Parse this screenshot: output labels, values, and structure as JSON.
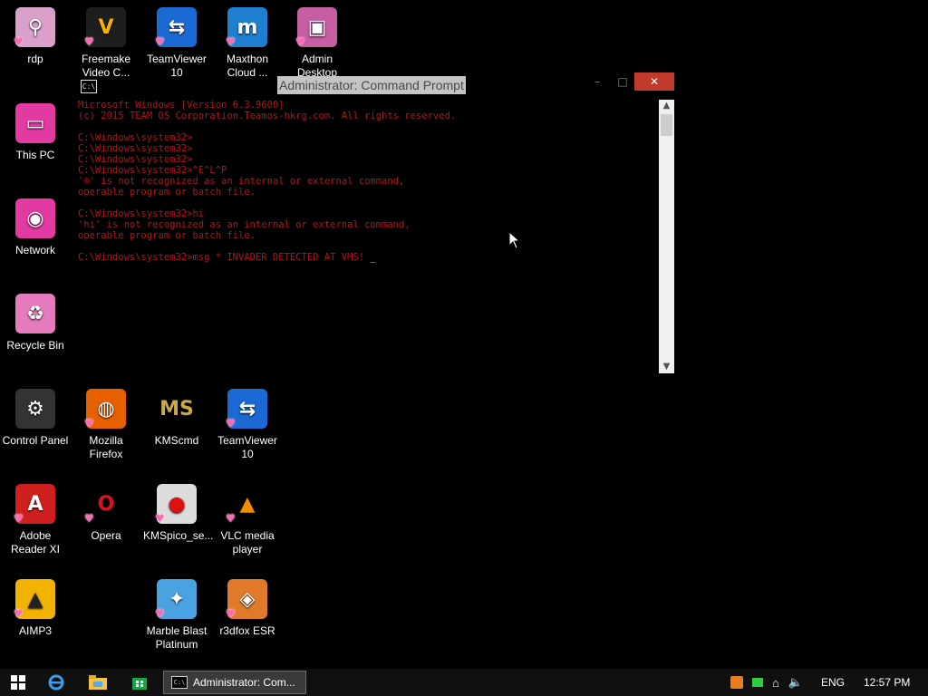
{
  "desktop": {
    "icons": [
      {
        "label": "rdp",
        "icon": "folder-icon",
        "glyph": "⚲",
        "bg": "#d9a0c9"
      },
      {
        "label": "Freemake Video C...",
        "icon": "freemake-icon",
        "glyph": "V",
        "bg": "#1e1e1e",
        "fg": "#f5b400"
      },
      {
        "label": "TeamViewer 10",
        "icon": "teamviewer-icon",
        "glyph": "⇆",
        "bg": "#1b6ad3"
      },
      {
        "label": "Maxthon Cloud ...",
        "icon": "maxthon-icon",
        "glyph": "m",
        "bg": "#1e7fd0"
      },
      {
        "label": "Admin Desktop",
        "icon": "folder-icon",
        "glyph": "▣",
        "bg": "#c75da3"
      },
      {
        "label": "This PC",
        "icon": "computer-icon",
        "glyph": "▭",
        "bg": "#e23aa0"
      },
      {
        "label": "Network",
        "icon": "network-icon",
        "glyph": "◉",
        "bg": "#e23aa0"
      },
      {
        "label": "Recycle Bin",
        "icon": "recycle-bin-icon",
        "glyph": "♻",
        "bg": "#e57bbd"
      },
      {
        "label": "Control Panel",
        "icon": "control-panel-icon",
        "glyph": "⚙",
        "bg": "#333333"
      },
      {
        "label": "Mozilla Firefox",
        "icon": "firefox-icon",
        "glyph": "◍",
        "bg": "#e66000"
      },
      {
        "label": "KMScmd",
        "icon": "kmscmd-icon",
        "glyph": "MS",
        "bg": "#000000",
        "fg": "#c9a94a"
      },
      {
        "label": "TeamViewer 10",
        "icon": "teamviewer-icon",
        "glyph": "⇆",
        "bg": "#1b6ad3"
      },
      {
        "label": "Adobe Reader XI",
        "icon": "adobe-reader-icon",
        "glyph": "A",
        "bg": "#d01f1f"
      },
      {
        "label": "Opera",
        "icon": "opera-icon",
        "glyph": "O",
        "bg": "#000000",
        "fg": "#e00f1f"
      },
      {
        "label": "KMSpico_se...",
        "icon": "kmspico-icon",
        "glyph": "●",
        "bg": "#dcdcdc",
        "fg": "#d11"
      },
      {
        "label": "VLC media player",
        "icon": "vlc-icon",
        "glyph": "▲",
        "bg": "#000000",
        "fg": "#f28c00"
      },
      {
        "label": "AIMP3",
        "icon": "aimp-icon",
        "glyph": "▲",
        "bg": "#f2b200",
        "fg": "#222"
      },
      {
        "label": "Marble Blast Platinum",
        "icon": "marble-blast-icon",
        "glyph": "✦",
        "bg": "#4aa3e0"
      },
      {
        "label": "r3dfox ESR",
        "icon": "r3dfox-icon",
        "glyph": "◈",
        "bg": "#e07a2a"
      }
    ]
  },
  "cmd_window": {
    "title": "Administrator: Command Prompt",
    "app_icon": "C:\\",
    "minimize": "–",
    "maximize": "□",
    "close": "✕",
    "lines": [
      "Microsoft Windows [Version 6.3.9600]",
      "(c) 2015 TEAM OS Corporation.Teamos-hkrg.com. All rights reserved.",
      "",
      "C:\\Windows\\system32>",
      "C:\\Windows\\system32>",
      "C:\\Windows\\system32>",
      "C:\\Windows\\system32>^E^L^P",
      "'®' is not recognized as an internal or external command,",
      "operable program or batch file.",
      "",
      "C:\\Windows\\system32>hi",
      "'hi' is not recognized as an internal or external command,",
      "operable program or batch file.",
      "",
      "C:\\Windows\\system32>msg * INVADER DETECTED AT VMS! "
    ],
    "cursor": "_"
  },
  "taskbar": {
    "active_task": "Administrator: Com...",
    "language": "ENG",
    "time": "12:57 PM"
  },
  "colors": {
    "console_text": "#b0161c",
    "close_button": "#c0392b",
    "taskbar": "#101010"
  }
}
